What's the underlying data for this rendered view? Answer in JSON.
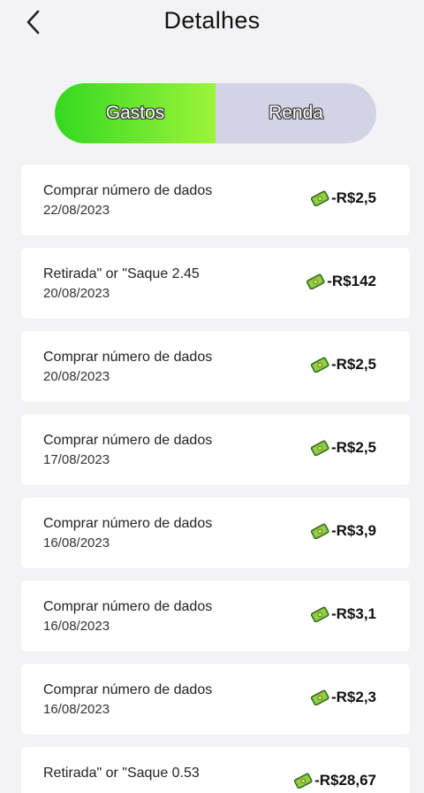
{
  "header": {
    "title": "Detalhes"
  },
  "tabs": [
    {
      "label": "Gastos",
      "active": true
    },
    {
      "label": "Renda",
      "active": false
    }
  ],
  "colors": {
    "accent_start": "#34d820",
    "accent_end": "#9cf43a",
    "inactive_tab": "#d4d3e6",
    "background": "#f3f3f6"
  },
  "transactions": [
    {
      "description": "Comprar número de dados",
      "date": "22/08/2023",
      "amount": "-R$2,5",
      "icon": "money-icon"
    },
    {
      "description": "Retirada\" or \"Saque 2.45",
      "date": "20/08/2023",
      "amount": "-R$142",
      "icon": "money-icon"
    },
    {
      "description": "Comprar número de dados",
      "date": "20/08/2023",
      "amount": "-R$2,5",
      "icon": "money-icon"
    },
    {
      "description": "Comprar número de dados",
      "date": "17/08/2023",
      "amount": "-R$2,5",
      "icon": "money-icon"
    },
    {
      "description": "Comprar número de dados",
      "date": "16/08/2023",
      "amount": "-R$3,9",
      "icon": "money-icon"
    },
    {
      "description": "Comprar número de dados",
      "date": "16/08/2023",
      "amount": "-R$3,1",
      "icon": "money-icon"
    },
    {
      "description": "Comprar número de dados",
      "date": "16/08/2023",
      "amount": "-R$2,3",
      "icon": "money-icon"
    },
    {
      "description": "Retirada\" or \"Saque 0.53",
      "date": "",
      "amount": "-R$28,67",
      "icon": "money-icon"
    }
  ]
}
